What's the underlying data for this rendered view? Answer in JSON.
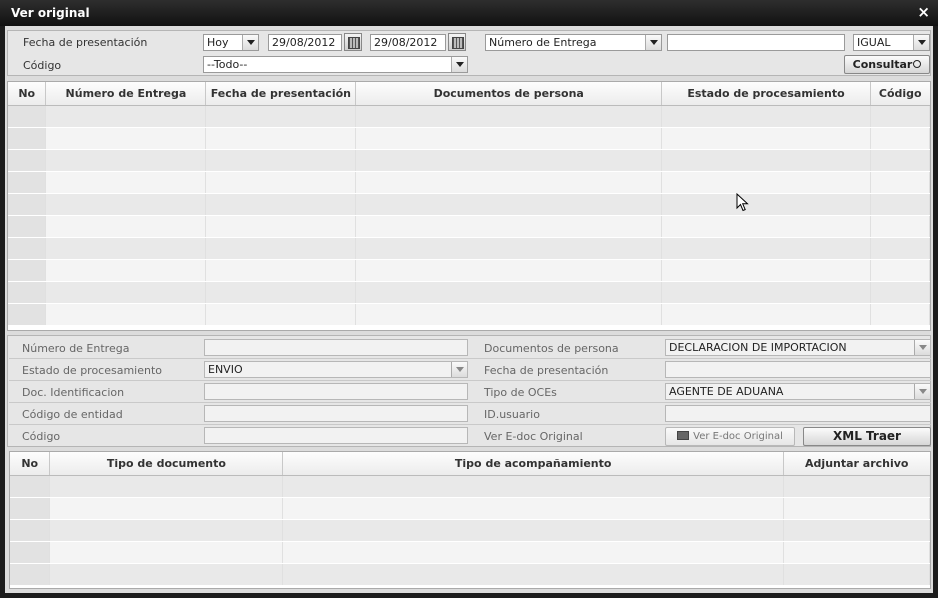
{
  "window": {
    "title": "Ver original",
    "close": "×"
  },
  "filter": {
    "fecha_label": "Fecha de presentación",
    "periodo": "Hoy",
    "fecha_desde": "29/08/2012",
    "fecha_hasta": "29/08/2012",
    "campo_busqueda": "Número de Entrega",
    "valor_busqueda": "",
    "operador": "IGUAL",
    "codigo_label": "Código",
    "codigo_valor": "--Todo--",
    "consultar": "Consultar"
  },
  "main_grid": {
    "columns": [
      "No",
      "Número de Entrega",
      "Fecha de presentación",
      "Documentos de persona",
      "Estado de procesamiento",
      "Código"
    ]
  },
  "detail": {
    "numero_entrega_label": "Número de Entrega",
    "numero_entrega_value": "",
    "documentos_label": "Documentos de persona",
    "documentos_value": "DECLARACION DE IMPORTACION",
    "estado_label": "Estado de procesamiento",
    "estado_value": "ENVIO",
    "fecha_label": "Fecha de presentación",
    "fecha_value": "",
    "doc_id_label": "Doc. Identificacion",
    "doc_id_value": "",
    "tipo_oces_label": "Tipo de OCEs",
    "tipo_oces_value": "AGENTE DE ADUANA",
    "codigo_entidad_label": "Código de entidad",
    "codigo_entidad_value": "",
    "id_usuario_label": "ID.usuario",
    "id_usuario_value": "",
    "codigo_label": "Código",
    "codigo_value": "",
    "ver_edoc_label": "Ver E-doc Original",
    "ver_edoc_button": "Ver E-doc Original",
    "xml_traer_button": "XML Traer"
  },
  "attach_grid": {
    "columns": [
      "No",
      "Tipo de documento",
      "Tipo de acompañamiento",
      "Adjuntar archivo"
    ]
  }
}
